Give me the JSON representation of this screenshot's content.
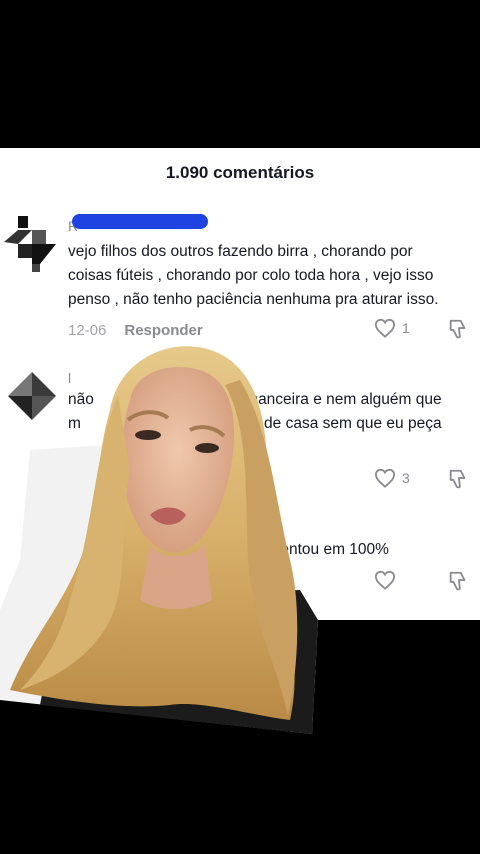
{
  "sheet": {
    "title": "1.090 comentários"
  },
  "comments": [
    {
      "username": "R",
      "text_lines": [
        "vejo filhos dos outros fazendo birra , chorando por",
        "coisas fúteis , chorando por colo toda hora , vejo isso",
        "penso , não tenho paciência nenhuma pra aturar isso."
      ],
      "date": "12-06",
      "reply_label": "Responder",
      "likes": "1"
    },
    {
      "username": "l",
      "text_lines": [
        "não",
        "inanceira e nem alguém que",
        "m",
        "s de casa sem que eu peça"
      ],
      "likes": "3"
    },
    {
      "text_lines": [
        "esentou em 100%"
      ],
      "likes": ""
    }
  ],
  "colors": {
    "sheet_bg": "#ffffff",
    "redaction": "#1f43e0",
    "text": "#161823",
    "muted": "#8a8b91"
  },
  "icons": [
    "heart-icon",
    "dislike-icon"
  ]
}
